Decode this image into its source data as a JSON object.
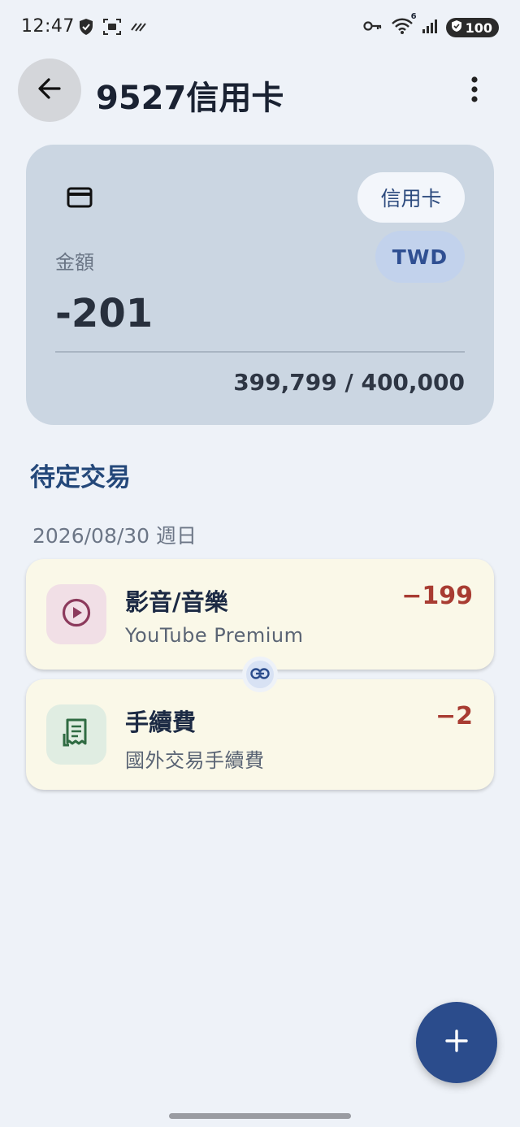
{
  "status_bar": {
    "time": "12:47",
    "battery": "100",
    "wifi_label": "6"
  },
  "app_bar": {
    "title": "9527信用卡"
  },
  "account_card": {
    "type_chip": "信用卡",
    "currency_chip": "TWD",
    "amount_label": "金額",
    "amount_value": "-201",
    "credit_usage": "399,799 / 400,000"
  },
  "pending": {
    "section_title": "待定交易",
    "date_header": "2026/08/30 週日",
    "transactions": [
      {
        "category": "影音/音樂",
        "description": "YouTube Premium",
        "amount": "−199",
        "icon": "play-circle-icon",
        "icon_bg": "#f1dfe6",
        "icon_color": "#8c3a5c"
      },
      {
        "category": "手續費",
        "description": "國外交易手續費",
        "amount": "−2",
        "icon": "receipt-icon",
        "icon_bg": "#e0ede2",
        "icon_color": "#2f6b42"
      }
    ]
  },
  "colors": {
    "accent": "#2b4c8c",
    "negative": "#a83c32",
    "background": "#eef2f8",
    "card": "#cbd6e2"
  }
}
